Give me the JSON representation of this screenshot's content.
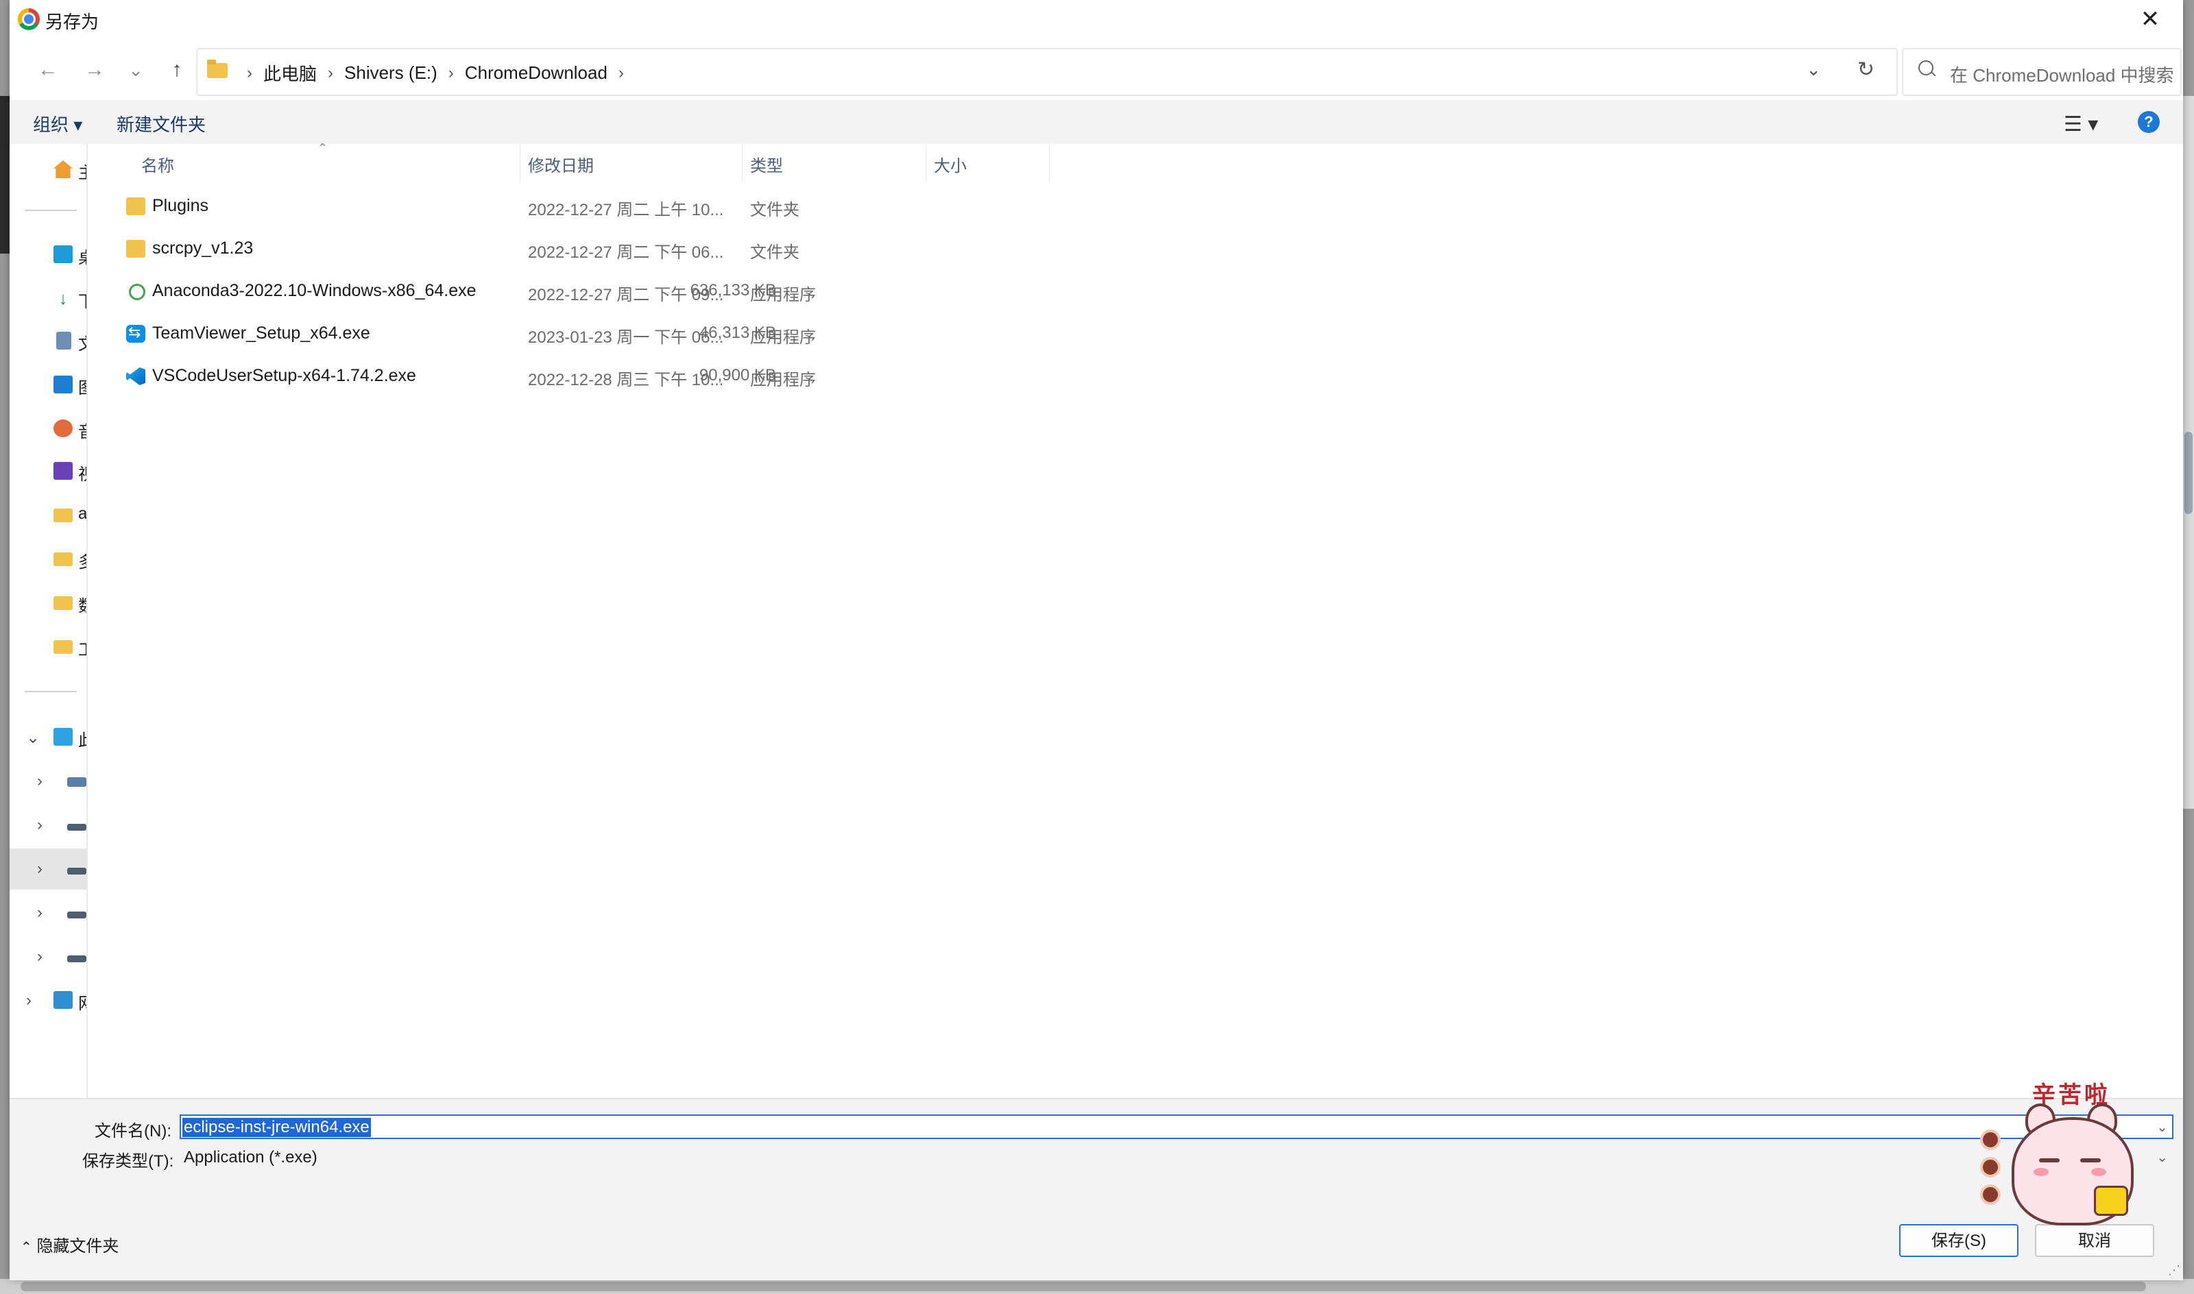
{
  "window": {
    "title": "另存为",
    "close_label": "✕"
  },
  "nav": {
    "back": "←",
    "forward": "→",
    "recent": "⌄",
    "up": "↑",
    "breadcrumb": [
      "此电脑",
      "Shivers (E:)",
      "ChromeDownload"
    ],
    "breadcrumb_sep": "›",
    "dropdown": "⌄",
    "refresh": "↻",
    "search_placeholder": "在 ChromeDownload 中搜索"
  },
  "toolbar": {
    "organize": "组织 ▾",
    "new_folder": "新建文件夹",
    "view_icon": "☰ ▾",
    "help": "?"
  },
  "columns": {
    "name": "名称",
    "date": "修改日期",
    "type": "类型",
    "size": "大小"
  },
  "files": [
    {
      "name": "Plugins",
      "date": "2022-12-27 周二 上午 10...",
      "type": "文件夹",
      "size": "",
      "icon": "folder-icon"
    },
    {
      "name": "scrcpy_v1.23",
      "date": "2022-12-27 周二 下午 06...",
      "type": "文件夹",
      "size": "",
      "icon": "folder-icon"
    },
    {
      "name": "Anaconda3-2022.10-Windows-x86_64.exe",
      "date": "2022-12-27 周二 下午 09...",
      "type": "应用程序",
      "size": "636,133 KB",
      "icon": "anaconda-icon"
    },
    {
      "name": "TeamViewer_Setup_x64.exe",
      "date": "2023-01-23 周一 下午 06...",
      "type": "应用程序",
      "size": "46,313 KB",
      "icon": "teamviewer-icon"
    },
    {
      "name": "VSCodeUserSetup-x64-1.74.2.exe",
      "date": "2022-12-28 周三 下午 10...",
      "type": "应用程序",
      "size": "90,900 KB",
      "icon": "vscode-icon"
    }
  ],
  "navpane": {
    "quick": [
      {
        "label": "主",
        "icon": "home-icon"
      },
      {
        "label": "桌",
        "icon": "desktop-icon"
      },
      {
        "label": "下",
        "icon": "download-icon"
      },
      {
        "label": "文",
        "icon": "documents-icon"
      },
      {
        "label": "图",
        "icon": "pictures-icon"
      },
      {
        "label": "音",
        "icon": "music-icon"
      },
      {
        "label": "视",
        "icon": "videos-icon"
      },
      {
        "label": "a",
        "icon": "folder-icon"
      },
      {
        "label": "多",
        "icon": "folder-icon"
      },
      {
        "label": "数",
        "icon": "folder-icon"
      },
      {
        "label": "工",
        "icon": "folder-icon"
      }
    ],
    "tree": [
      {
        "label": "此",
        "icon": "this-pc-icon",
        "chev": "⌄"
      },
      {
        "label": "",
        "icon": "drive-icon",
        "chev": "›"
      },
      {
        "label": "",
        "icon": "drive-icon",
        "chev": "›"
      },
      {
        "label": "",
        "icon": "drive-icon",
        "chev": "›"
      },
      {
        "label": "",
        "icon": "drive-icon",
        "chev": "›"
      },
      {
        "label": "",
        "icon": "drive-icon",
        "chev": "›"
      },
      {
        "label": "网",
        "icon": "network-icon",
        "chev": "›"
      }
    ]
  },
  "save": {
    "filename_label": "文件名(N):",
    "filename_value": "eclipse-inst-jre-win64.exe",
    "filetype_label": "保存类型(T):",
    "filetype_value": "Application (*.exe)",
    "hide_folders": "隐藏文件夹",
    "save_button": "保存(S)",
    "cancel_button": "取消"
  },
  "sticker": {
    "text": "辛苦啦"
  },
  "colors": {
    "accent": "#1f66d6",
    "folder": "#f3c24c",
    "header_text": "#4a5e7a"
  }
}
